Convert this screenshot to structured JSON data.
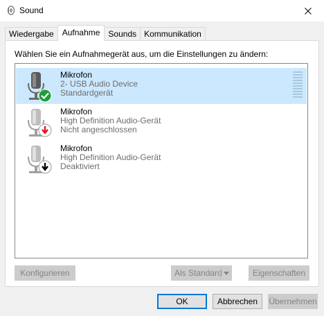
{
  "window": {
    "title": "Sound"
  },
  "tabs": [
    {
      "label": "Wiedergabe"
    },
    {
      "label": "Aufnahme",
      "active": true
    },
    {
      "label": "Sounds"
    },
    {
      "label": "Kommunikation"
    }
  ],
  "panel": {
    "instruction": "Wählen Sie ein Aufnahmegerät aus, um die Einstellungen zu ändern:"
  },
  "devices": [
    {
      "name": "Mikrofon",
      "driver": "2- USB Audio Device",
      "status": "Standardgerät",
      "status_icon": "green-check-icon",
      "selected": true
    },
    {
      "name": "Mikrofon",
      "driver": "High Definition Audio-Gerät",
      "status": "Nicht angeschlossen",
      "status_icon": "red-down-arrow-icon"
    },
    {
      "name": "Mikrofon",
      "driver": "High Definition Audio-Gerät",
      "status": "Deaktiviert",
      "status_icon": "black-down-arrow-icon"
    }
  ],
  "buttons": {
    "configure": "Konfigurieren",
    "set_default": "Als Standard",
    "properties": "Eigenschaften",
    "ok": "OK",
    "cancel": "Abbrechen",
    "apply": "Übernehmen"
  },
  "colors": {
    "selection": "#cce8ff",
    "accent": "#0078d7",
    "ok_check": "#1e9e3a",
    "unplugged_arrow": "#e81123"
  }
}
